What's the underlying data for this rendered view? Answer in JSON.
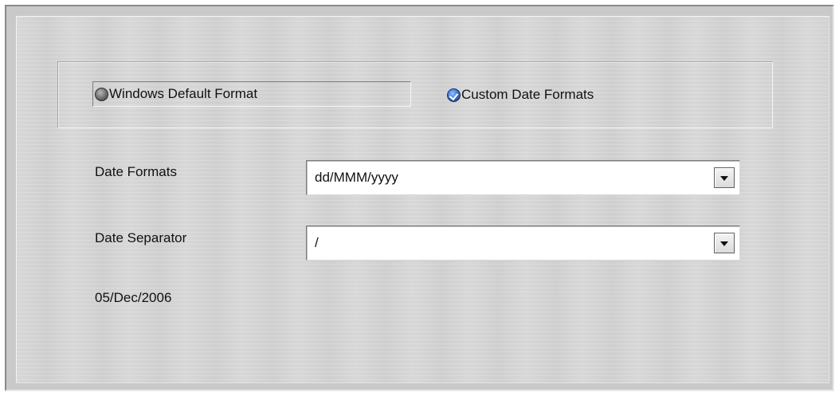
{
  "format_mode": {
    "windows_default_label": "Windows Default Format",
    "custom_label": "Custom Date Formats",
    "selected": "custom"
  },
  "date_formats": {
    "label": "Date Formats",
    "value": "dd/MMM/yyyy"
  },
  "date_separator": {
    "label": "Date Separator",
    "value": "/"
  },
  "preview": {
    "text": "05/Dec/2006"
  },
  "icons": {
    "radio_off": "radio-unchecked-icon",
    "radio_on": "radio-checked-icon",
    "dropdown": "chevron-down-icon"
  },
  "colors": {
    "panel_bg": "#d6d6d6",
    "radio_selected": "#2e68cc"
  }
}
